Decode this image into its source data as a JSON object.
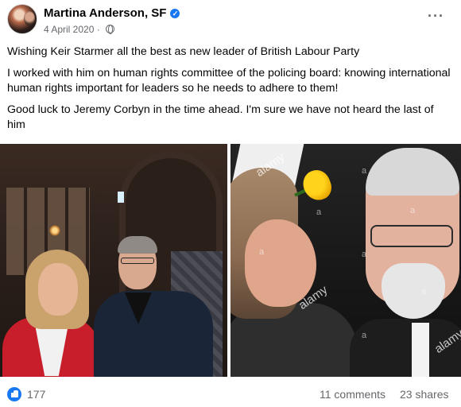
{
  "post": {
    "author": "Martina Anderson, SF",
    "date": "4 April 2020 · ",
    "audience_icon": "globe-icon",
    "more_icon": "more-options-icon",
    "verified_icon": "verified-badge-icon",
    "paragraphs": [
      "Wishing Keir Starmer all the best as new leader of British Labour Party",
      "I worked with him on human rights committee of the policing board: knowing international human rights important for leaders so he needs to adhere to them!",
      "Good luck to Jeremy Corbyn in the time ahead. I'm sure we have not heard the last of him"
    ],
    "photos": {
      "right_watermarks": [
        "alamy",
        "alamy",
        "alamy",
        "a",
        "a",
        "a",
        "a",
        "a",
        "a",
        "a"
      ]
    }
  },
  "footer": {
    "reaction_icon": "like-icon",
    "likes": "177",
    "comments": "11 comments",
    "shares": "23 shares"
  },
  "colors": {
    "brand_blue": "#1877f2",
    "secondary_text": "#65676b",
    "primary_text": "#050505"
  }
}
